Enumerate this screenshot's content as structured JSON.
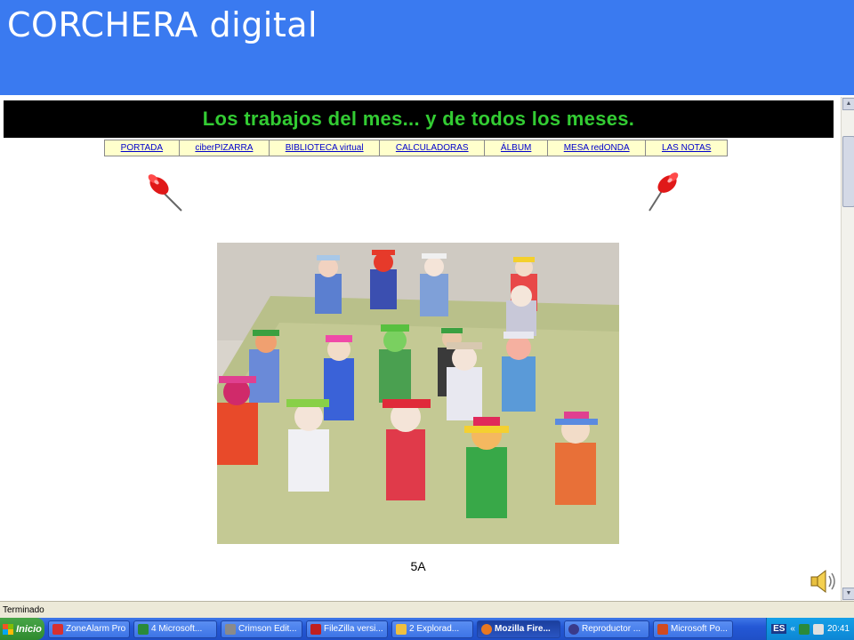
{
  "slide": {
    "title": "CORCHERA digital"
  },
  "page": {
    "banner": "Los trabajos del mes... y de todos los meses.",
    "nav": [
      {
        "label": "PORTADA"
      },
      {
        "label": "ciberPIZARRA"
      },
      {
        "label": "BIBLIOTECA virtual"
      },
      {
        "label": "CALCULADORAS"
      },
      {
        "label": "ÁLBUM"
      },
      {
        "label": "MESA redONDA"
      },
      {
        "label": "LAS NOTAS"
      }
    ],
    "caption": "5A"
  },
  "browser": {
    "status": "Terminado"
  },
  "taskbar": {
    "start": "Inicio",
    "items": [
      {
        "label": "ZoneAlarm Pro",
        "icon": "zonealarm-icon"
      },
      {
        "label": "4 Microsoft...",
        "icon": "excel-icon"
      },
      {
        "label": "Crimson Edit...",
        "icon": "crimson-editor-icon"
      },
      {
        "label": "FileZilla versi...",
        "icon": "filezilla-icon"
      },
      {
        "label": "2 Explorad...",
        "icon": "folder-icon"
      },
      {
        "label": "Mozilla Fire...",
        "icon": "firefox-icon"
      },
      {
        "label": "Reproductor ...",
        "icon": "media-player-icon"
      },
      {
        "label": "Microsoft Po...",
        "icon": "powerpoint-icon"
      }
    ],
    "tray": {
      "lang": "ES",
      "clock": "20:41"
    }
  },
  "colors": {
    "header": "#3a7af0",
    "banner_text": "#33cc33",
    "taskbar": "#2458d6"
  }
}
